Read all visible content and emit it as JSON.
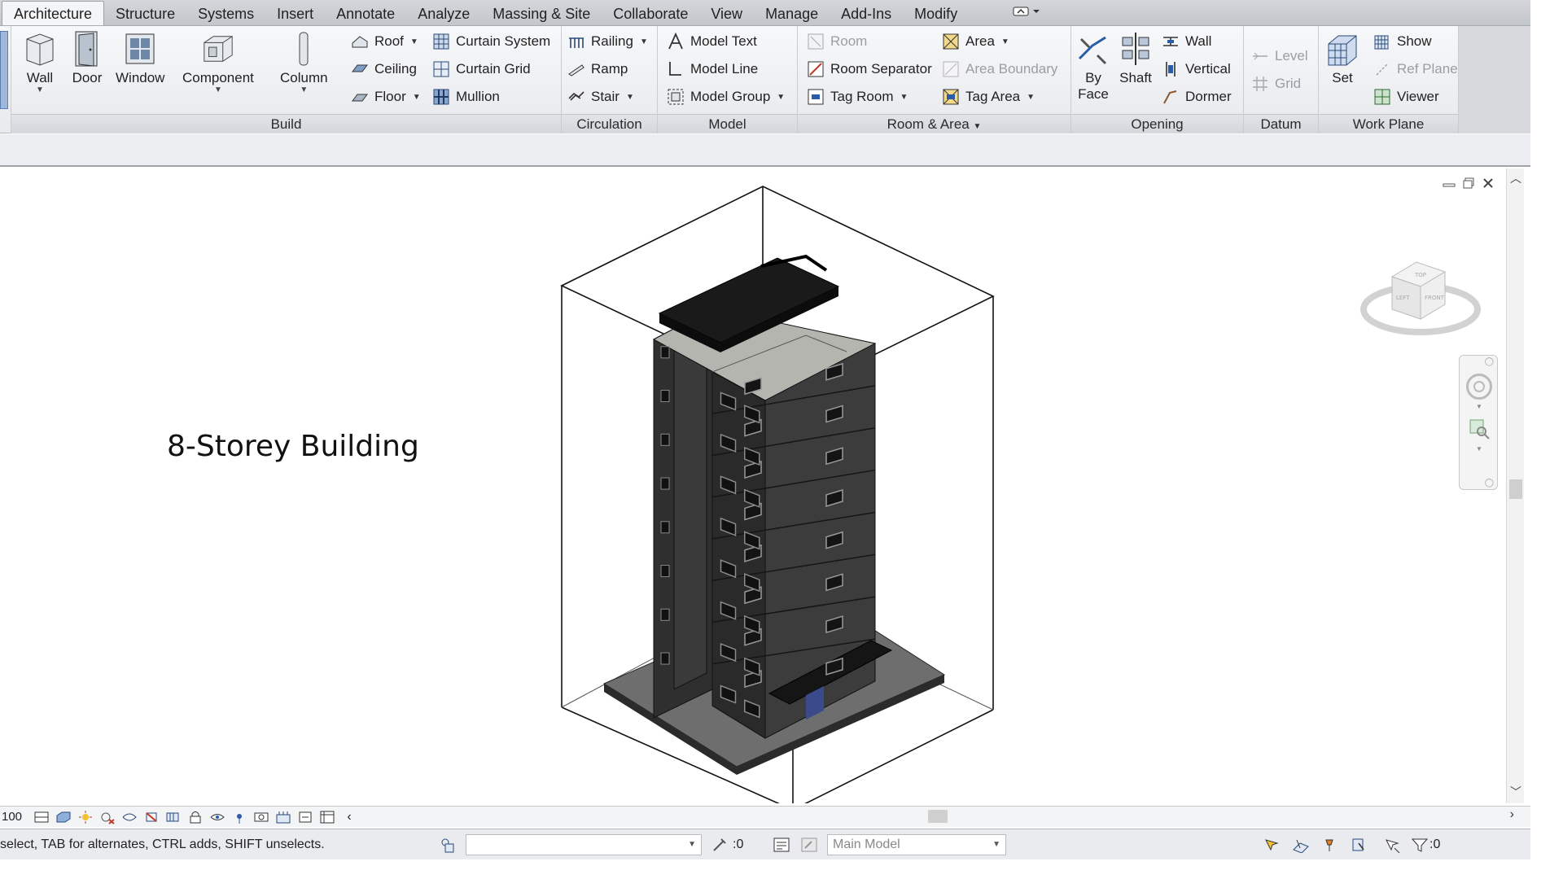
{
  "tabs": [
    {
      "label": "Architecture",
      "active": true
    },
    {
      "label": "Structure"
    },
    {
      "label": "Systems"
    },
    {
      "label": "Insert"
    },
    {
      "label": "Annotate"
    },
    {
      "label": "Analyze"
    },
    {
      "label": "Massing & Site"
    },
    {
      "label": "Collaborate"
    },
    {
      "label": "View"
    },
    {
      "label": "Manage"
    },
    {
      "label": "Add-Ins"
    },
    {
      "label": "Modify"
    }
  ],
  "panels": {
    "build": {
      "title": "Build",
      "big": [
        {
          "label": "Wall",
          "icon": "wall-icon"
        },
        {
          "label": "Door",
          "icon": "door-icon"
        },
        {
          "label": "Window",
          "icon": "window-icon"
        },
        {
          "label": "Component",
          "icon": "component-icon"
        },
        {
          "label": "Column",
          "icon": "column-icon"
        }
      ],
      "small": [
        {
          "label": "Roof",
          "icon": "roof-icon"
        },
        {
          "label": "Ceiling",
          "icon": "ceiling-icon"
        },
        {
          "label": "Floor",
          "icon": "floor-icon"
        },
        {
          "label": "Curtain System",
          "icon": "curtain-system-icon"
        },
        {
          "label": "Curtain Grid",
          "icon": "curtain-grid-icon"
        },
        {
          "label": "Mullion",
          "icon": "mullion-icon"
        }
      ]
    },
    "circulation": {
      "title": "Circulation",
      "small": [
        {
          "label": "Railing",
          "icon": "railing-icon"
        },
        {
          "label": "Ramp",
          "icon": "ramp-icon"
        },
        {
          "label": "Stair",
          "icon": "stair-icon"
        }
      ]
    },
    "model": {
      "title": "Model",
      "small": [
        {
          "label": "Model Text",
          "icon": "model-text-icon"
        },
        {
          "label": "Model Line",
          "icon": "model-line-icon"
        },
        {
          "label": "Model Group",
          "icon": "model-group-icon"
        }
      ]
    },
    "room_area": {
      "title": "Room & Area",
      "small": [
        {
          "label": "Room",
          "icon": "room-icon",
          "disabled": true
        },
        {
          "label": "Room Separator",
          "icon": "room-separator-icon"
        },
        {
          "label": "Tag Room",
          "icon": "tag-room-icon"
        },
        {
          "label": "Area",
          "icon": "area-icon"
        },
        {
          "label": "Area Boundary",
          "icon": "area-boundary-icon",
          "disabled": true
        },
        {
          "label": "Tag Area",
          "icon": "tag-area-icon"
        }
      ]
    },
    "opening": {
      "title": "Opening",
      "big": [
        {
          "label": "By",
          "label2": "Face",
          "icon": "by-face-icon"
        },
        {
          "label": "Shaft",
          "icon": "shaft-icon"
        }
      ],
      "small": [
        {
          "label": "Wall",
          "icon": "wall-opening-icon"
        },
        {
          "label": "Vertical",
          "icon": "vertical-opening-icon"
        },
        {
          "label": "Dormer",
          "icon": "dormer-icon"
        }
      ]
    },
    "datum": {
      "title": "Datum",
      "small": [
        {
          "label": "Level",
          "icon": "level-icon",
          "disabled": true
        },
        {
          "label": "Grid",
          "icon": "grid-icon",
          "disabled": true
        }
      ]
    },
    "work_plane": {
      "title": "Work Plane",
      "big": [
        {
          "label": "Set",
          "icon": "set-workplane-icon"
        }
      ],
      "small": [
        {
          "label": "Show",
          "icon": "show-workplane-icon"
        },
        {
          "label": "Ref Plane",
          "icon": "ref-plane-icon",
          "disabled": true
        },
        {
          "label": "Viewer",
          "icon": "viewer-icon"
        }
      ]
    }
  },
  "viewport": {
    "label": "8-Storey Building",
    "viewcube_faces": {
      "top": "TOP",
      "left": "LEFT",
      "front": "FRONT"
    }
  },
  "viewbar": {
    "scale": "100"
  },
  "statusbar": {
    "message": "select, TAB for alternates, CTRL adds, SHIFT unselects.",
    "selection_count": ":0",
    "model": "Main Model",
    "filter_count": ":0"
  },
  "colors": {
    "accent": "#2a5caa",
    "building": "#3a3a3a",
    "roof": "#1c1c1c",
    "ribbon_bg": "#eceef1"
  }
}
